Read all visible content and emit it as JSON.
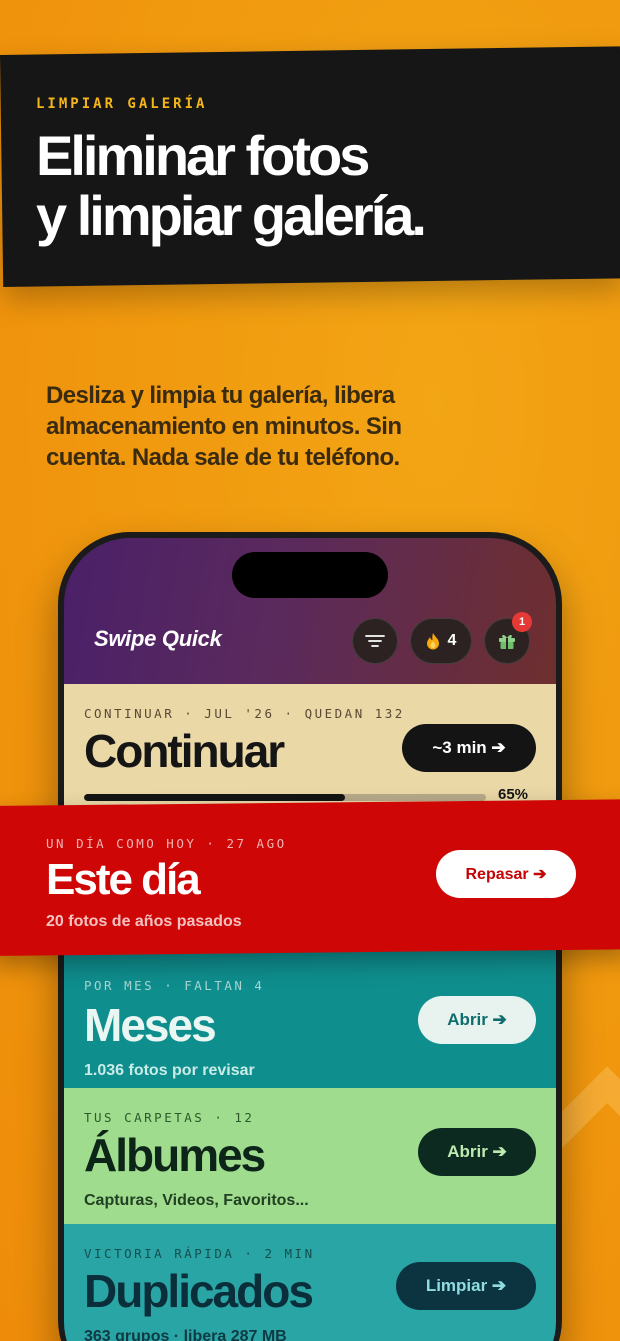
{
  "hero": {
    "eyebrow": "LIMPIAR GALERÍA",
    "headline_line1": "Eliminar fotos",
    "headline_line2": "y limpiar galería.",
    "subtext": "Desliza y limpia tu galería, libera almacenamiento en minutos. Sin cuenta. Nada sale de tu teléfono."
  },
  "app": {
    "title": "Swipe Quick",
    "streak_count": "4",
    "gift_badge": "1",
    "icons": [
      "filter-icon",
      "flame-icon",
      "gift-icon"
    ]
  },
  "continue_card": {
    "eyebrow": "CONTINUAR · JUL '26 · QUEDAN 132",
    "title": "Continuar",
    "button": "~3 min ➔",
    "progress_label": "65%",
    "progress_value": 0.65
  },
  "today_banner": {
    "eyebrow": "UN DÍA COMO HOY · 27 AGO",
    "title": "Este día",
    "subtitle": "20 fotos de años pasados",
    "button": "Repasar ➔"
  },
  "months_card": {
    "eyebrow": "POR MES · FALTAN 4",
    "title": "Meses",
    "subtitle": "1.036 fotos por revisar",
    "button": "Abrir ➔"
  },
  "albums_card": {
    "eyebrow": "TUS CARPETAS · 12",
    "title": "Álbumes",
    "subtitle": "Capturas, Videos, Favoritos...",
    "button": "Abrir ➔"
  },
  "duplicates_card": {
    "eyebrow": "VICTORIA RÁPIDA · 2 MIN",
    "title": "Duplicados",
    "subtitle": "363 grupos · libera 287 MB",
    "button": "Limpiar ➔"
  },
  "colors": {
    "background": "#f19a0f",
    "header_band": "#161616",
    "accent_yellow": "#f3b51c",
    "banner_red": "#cf0606"
  }
}
